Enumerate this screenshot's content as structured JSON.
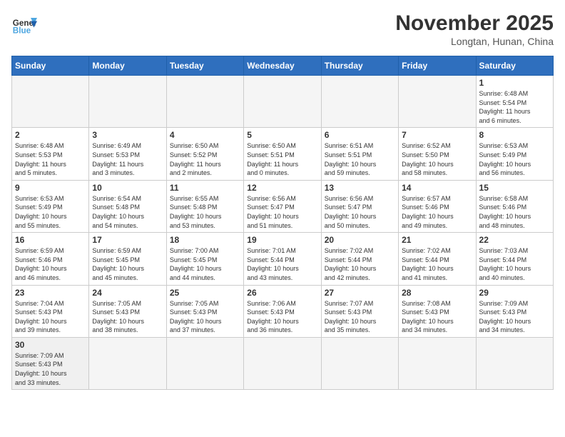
{
  "header": {
    "logo_general": "General",
    "logo_blue": "Blue",
    "month_title": "November 2025",
    "subtitle": "Longtan, Hunan, China"
  },
  "weekdays": [
    "Sunday",
    "Monday",
    "Tuesday",
    "Wednesday",
    "Thursday",
    "Friday",
    "Saturday"
  ],
  "weeks": [
    [
      {
        "day": "",
        "info": ""
      },
      {
        "day": "",
        "info": ""
      },
      {
        "day": "",
        "info": ""
      },
      {
        "day": "",
        "info": ""
      },
      {
        "day": "",
        "info": ""
      },
      {
        "day": "",
        "info": ""
      },
      {
        "day": "1",
        "info": "Sunrise: 6:48 AM\nSunset: 5:54 PM\nDaylight: 11 hours\nand 6 minutes."
      }
    ],
    [
      {
        "day": "2",
        "info": "Sunrise: 6:48 AM\nSunset: 5:53 PM\nDaylight: 11 hours\nand 5 minutes."
      },
      {
        "day": "3",
        "info": "Sunrise: 6:49 AM\nSunset: 5:53 PM\nDaylight: 11 hours\nand 3 minutes."
      },
      {
        "day": "4",
        "info": "Sunrise: 6:50 AM\nSunset: 5:52 PM\nDaylight: 11 hours\nand 2 minutes."
      },
      {
        "day": "5",
        "info": "Sunrise: 6:50 AM\nSunset: 5:51 PM\nDaylight: 11 hours\nand 0 minutes."
      },
      {
        "day": "6",
        "info": "Sunrise: 6:51 AM\nSunset: 5:51 PM\nDaylight: 10 hours\nand 59 minutes."
      },
      {
        "day": "7",
        "info": "Sunrise: 6:52 AM\nSunset: 5:50 PM\nDaylight: 10 hours\nand 58 minutes."
      },
      {
        "day": "8",
        "info": "Sunrise: 6:53 AM\nSunset: 5:49 PM\nDaylight: 10 hours\nand 56 minutes."
      }
    ],
    [
      {
        "day": "9",
        "info": "Sunrise: 6:53 AM\nSunset: 5:49 PM\nDaylight: 10 hours\nand 55 minutes."
      },
      {
        "day": "10",
        "info": "Sunrise: 6:54 AM\nSunset: 5:48 PM\nDaylight: 10 hours\nand 54 minutes."
      },
      {
        "day": "11",
        "info": "Sunrise: 6:55 AM\nSunset: 5:48 PM\nDaylight: 10 hours\nand 53 minutes."
      },
      {
        "day": "12",
        "info": "Sunrise: 6:56 AM\nSunset: 5:47 PM\nDaylight: 10 hours\nand 51 minutes."
      },
      {
        "day": "13",
        "info": "Sunrise: 6:56 AM\nSunset: 5:47 PM\nDaylight: 10 hours\nand 50 minutes."
      },
      {
        "day": "14",
        "info": "Sunrise: 6:57 AM\nSunset: 5:46 PM\nDaylight: 10 hours\nand 49 minutes."
      },
      {
        "day": "15",
        "info": "Sunrise: 6:58 AM\nSunset: 5:46 PM\nDaylight: 10 hours\nand 48 minutes."
      }
    ],
    [
      {
        "day": "16",
        "info": "Sunrise: 6:59 AM\nSunset: 5:46 PM\nDaylight: 10 hours\nand 46 minutes."
      },
      {
        "day": "17",
        "info": "Sunrise: 6:59 AM\nSunset: 5:45 PM\nDaylight: 10 hours\nand 45 minutes."
      },
      {
        "day": "18",
        "info": "Sunrise: 7:00 AM\nSunset: 5:45 PM\nDaylight: 10 hours\nand 44 minutes."
      },
      {
        "day": "19",
        "info": "Sunrise: 7:01 AM\nSunset: 5:44 PM\nDaylight: 10 hours\nand 43 minutes."
      },
      {
        "day": "20",
        "info": "Sunrise: 7:02 AM\nSunset: 5:44 PM\nDaylight: 10 hours\nand 42 minutes."
      },
      {
        "day": "21",
        "info": "Sunrise: 7:02 AM\nSunset: 5:44 PM\nDaylight: 10 hours\nand 41 minutes."
      },
      {
        "day": "22",
        "info": "Sunrise: 7:03 AM\nSunset: 5:44 PM\nDaylight: 10 hours\nand 40 minutes."
      }
    ],
    [
      {
        "day": "23",
        "info": "Sunrise: 7:04 AM\nSunset: 5:43 PM\nDaylight: 10 hours\nand 39 minutes."
      },
      {
        "day": "24",
        "info": "Sunrise: 7:05 AM\nSunset: 5:43 PM\nDaylight: 10 hours\nand 38 minutes."
      },
      {
        "day": "25",
        "info": "Sunrise: 7:05 AM\nSunset: 5:43 PM\nDaylight: 10 hours\nand 37 minutes."
      },
      {
        "day": "26",
        "info": "Sunrise: 7:06 AM\nSunset: 5:43 PM\nDaylight: 10 hours\nand 36 minutes."
      },
      {
        "day": "27",
        "info": "Sunrise: 7:07 AM\nSunset: 5:43 PM\nDaylight: 10 hours\nand 35 minutes."
      },
      {
        "day": "28",
        "info": "Sunrise: 7:08 AM\nSunset: 5:43 PM\nDaylight: 10 hours\nand 34 minutes."
      },
      {
        "day": "29",
        "info": "Sunrise: 7:09 AM\nSunset: 5:43 PM\nDaylight: 10 hours\nand 34 minutes."
      }
    ],
    [
      {
        "day": "30",
        "info": "Sunrise: 7:09 AM\nSunset: 5:43 PM\nDaylight: 10 hours\nand 33 minutes."
      },
      {
        "day": "",
        "info": ""
      },
      {
        "day": "",
        "info": ""
      },
      {
        "day": "",
        "info": ""
      },
      {
        "day": "",
        "info": ""
      },
      {
        "day": "",
        "info": ""
      },
      {
        "day": "",
        "info": ""
      }
    ]
  ]
}
